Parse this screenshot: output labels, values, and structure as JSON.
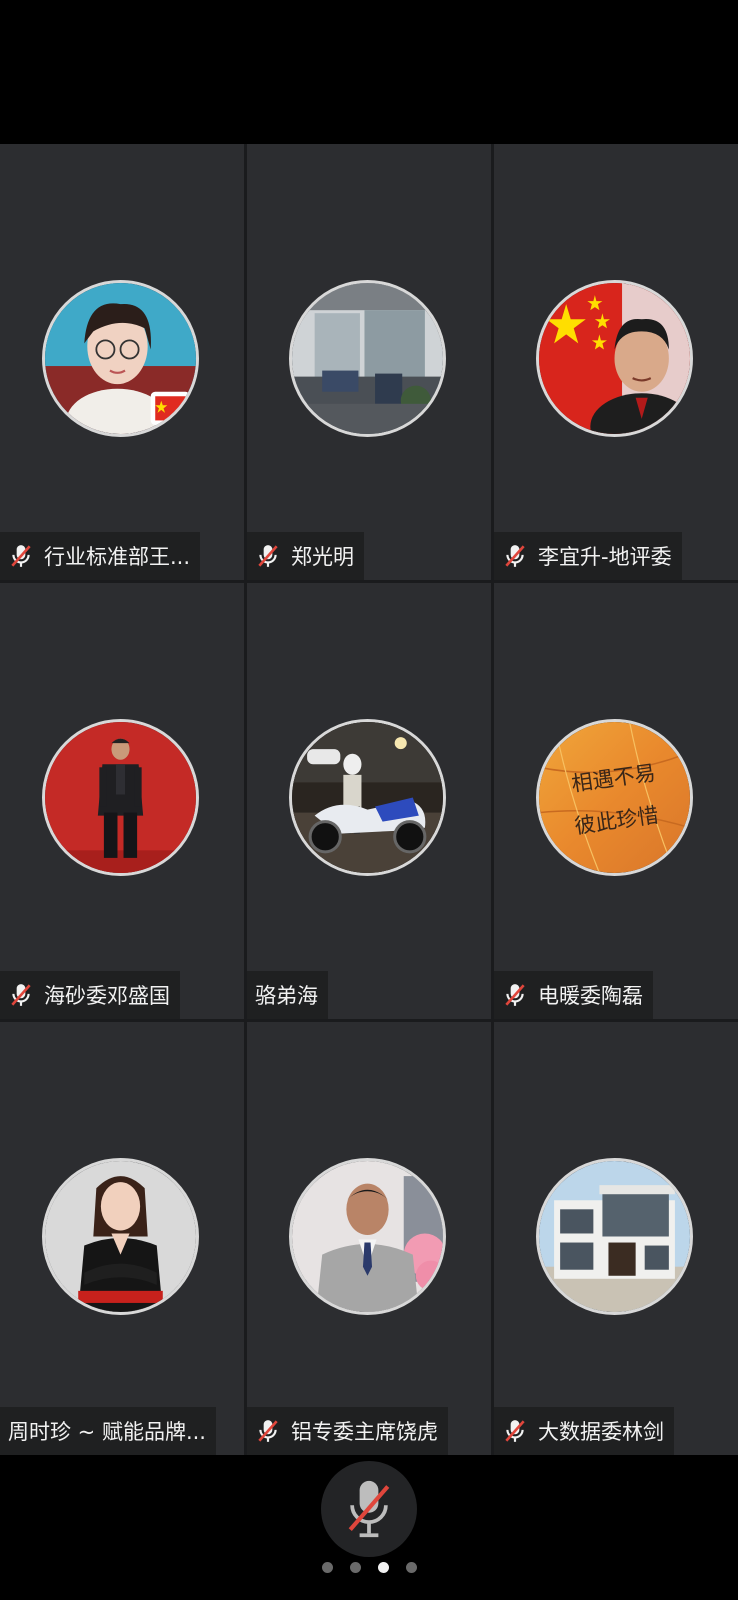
{
  "participants": [
    {
      "name": "行业标准部王...",
      "muted": true,
      "avatar": "woman-with-glasses-flag-avatar"
    },
    {
      "name": "郑光明",
      "muted": true,
      "avatar": "office-interior-avatar"
    },
    {
      "name": "李宜升-地评委",
      "muted": true,
      "avatar": "man-with-china-flag-avatar"
    },
    {
      "name": "海砂委邓盛国",
      "muted": true,
      "avatar": "man-standing-red-background-avatar"
    },
    {
      "name": "骆弟海",
      "muted": false,
      "avatar": "motorcycle-night-avatar"
    },
    {
      "name": "电暖委陶磊",
      "muted": true,
      "avatar": "leaf-calligraphy-avatar"
    },
    {
      "name": "周时珍 ~ 赋能品牌...",
      "muted": false,
      "avatar": "woman-in-black-suit-avatar"
    },
    {
      "name": "铝专委主席饶虎",
      "muted": true,
      "avatar": "man-in-grey-suit-avatar"
    },
    {
      "name": "大数据委林剑",
      "muted": true,
      "avatar": "modern-house-avatar"
    }
  ],
  "avatar_calligraphy": {
    "line1": "相遇不易",
    "line2": "彼此珍惜"
  },
  "controls": {
    "mic_icon": "mic-off-icon",
    "pages": 4,
    "active_page": 3
  },
  "colors": {
    "tile_bg": "#2c2d30",
    "mute_red": "#e0463c",
    "active_dot": "#f2f2f2"
  }
}
